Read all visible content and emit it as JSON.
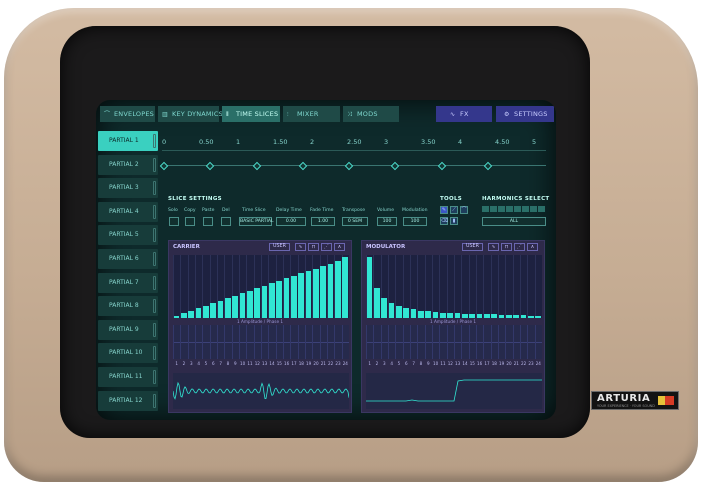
{
  "tabs": [
    {
      "label": "ENVELOPES",
      "icon": "mountain-icon"
    },
    {
      "label": "KEY DYNAMICS",
      "icon": "keys-icon"
    },
    {
      "label": "TIME SLICES",
      "icon": "slices-icon",
      "active": true
    },
    {
      "label": "MIXER",
      "icon": "fader-icon"
    },
    {
      "label": "MODS",
      "icon": "mods-icon"
    },
    {
      "label": "FX",
      "icon": "wave-icon"
    },
    {
      "label": "SETTINGS",
      "icon": "gear-icon"
    }
  ],
  "partials": [
    "PARTIAL 1",
    "PARTIAL 2",
    "PARTIAL 3",
    "PARTIAL 4",
    "PARTIAL 5",
    "PARTIAL 6",
    "PARTIAL 7",
    "PARTIAL 8",
    "PARTIAL 9",
    "PARTIAL 10",
    "PARTIAL 11",
    "PARTIAL 12"
  ],
  "timeline": {
    "ruler": [
      "0",
      "0.50",
      "1",
      "1.50",
      "2",
      "2.50",
      "3",
      "3.50",
      "4",
      "4.50",
      "5"
    ],
    "slice_points": [
      0,
      0.62,
      1.25,
      1.88,
      2.5,
      3.12,
      3.75,
      4.38
    ]
  },
  "slice_settings": {
    "title": "SLICE SETTINGS",
    "solo_label": "Solo",
    "copy_label": "Copy",
    "paste_label": "Paste",
    "del_label": "Del",
    "time_slice_label": "Time Slice",
    "time_slice_value": "BASIC PARTIAL",
    "delay_time_label": "Delay Time",
    "delay_time_value": "0.00",
    "fade_time_label": "Fade Time",
    "fade_time_value": "1.00",
    "transpose_label": "Transpose",
    "transpose_value": "0 SEM",
    "volume_label": "Volume",
    "volume_value": "100",
    "modulation_label": "Modulation",
    "modulation_value": "100"
  },
  "tools": {
    "title": "TOOLS"
  },
  "harmonics": {
    "title": "HARMONICS SELECT",
    "value": "ALL"
  },
  "carrier": {
    "title": "CARRIER",
    "user_label": "USER",
    "amp_label": "1  Amplitude / Phase  1",
    "harmonics": [
      0.04,
      0.08,
      0.12,
      0.16,
      0.2,
      0.24,
      0.28,
      0.32,
      0.36,
      0.41,
      0.45,
      0.49,
      0.53,
      0.57,
      0.61,
      0.65,
      0.69,
      0.73,
      0.77,
      0.81,
      0.85,
      0.89,
      0.94,
      1.0
    ]
  },
  "modulator": {
    "title": "MODULATOR",
    "user_label": "USER",
    "amp_label": "1  Amplitude / Phase  1",
    "harmonics": [
      1.0,
      0.5,
      0.33,
      0.25,
      0.2,
      0.17,
      0.14,
      0.12,
      0.11,
      0.1,
      0.09,
      0.08,
      0.08,
      0.07,
      0.07,
      0.06,
      0.06,
      0.06,
      0.05,
      0.05,
      0.05,
      0.05,
      0.04,
      0.04
    ]
  },
  "harmonic_numbers": [
    "1",
    "2",
    "3",
    "4",
    "5",
    "6",
    "7",
    "8",
    "9",
    "10",
    "11",
    "12",
    "13",
    "14",
    "15",
    "16",
    "17",
    "18",
    "19",
    "20",
    "21",
    "22",
    "23",
    "24"
  ],
  "brand": {
    "name": "ARTURIA",
    "tagline": "YOUR EXPERIENCE · YOUR SOUND"
  }
}
